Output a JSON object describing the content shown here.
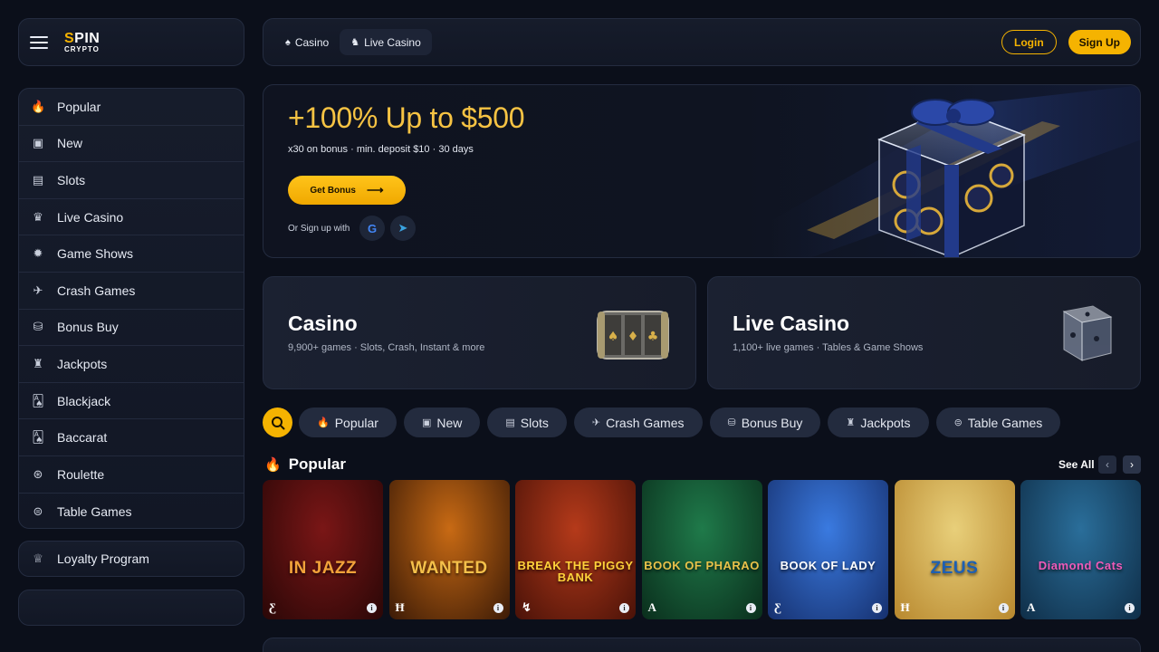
{
  "brand": {
    "line1_accent": "S",
    "line1_rest": "PIN",
    "line2": "CRYPTO"
  },
  "sidebar": {
    "items": [
      {
        "label": "Popular",
        "icon": "flame-icon",
        "glyph": "🔥"
      },
      {
        "label": "New",
        "icon": "new-box-icon",
        "glyph": "▣"
      },
      {
        "label": "Slots",
        "icon": "slot-machine-icon",
        "glyph": "▤"
      },
      {
        "label": "Live Casino",
        "icon": "dealer-icon",
        "glyph": "♛"
      },
      {
        "label": "Game Shows",
        "icon": "wheel-icon",
        "glyph": "✹"
      },
      {
        "label": "Crash Games",
        "icon": "plane-icon",
        "glyph": "✈"
      },
      {
        "label": "Bonus Buy",
        "icon": "coins-icon",
        "glyph": "⛁"
      },
      {
        "label": "Jackpots",
        "icon": "crown-stack-icon",
        "glyph": "♜"
      },
      {
        "label": "Blackjack",
        "icon": "cards-icon",
        "glyph": "🂡"
      },
      {
        "label": "Baccarat",
        "icon": "cards-icon",
        "glyph": "🂡"
      },
      {
        "label": "Roulette",
        "icon": "roulette-icon",
        "glyph": "⊛"
      },
      {
        "label": "Table Games",
        "icon": "table-icon",
        "glyph": "⊜"
      }
    ],
    "loyalty": {
      "label": "Loyalty Program",
      "icon": "crown-icon",
      "glyph": "♕"
    }
  },
  "topbar": {
    "tabs": [
      {
        "label": "Casino",
        "glyph": "♠"
      },
      {
        "label": "Live Casino",
        "glyph": "♞"
      }
    ],
    "login_label": "Login",
    "signup_label": "Sign Up"
  },
  "hero": {
    "title": "+100% Up to $500",
    "subtitle": "x30 on bonus · min. deposit $10 · 30 days",
    "cta_label": "Get Bonus",
    "cta_arrow": "⟶",
    "or_signup": "Or Sign up with",
    "google_glyph": "G",
    "telegram_glyph": "➤"
  },
  "categories": [
    {
      "title": "Casino",
      "subtitle": "9,900+ games · Slots, Crash, Instant & more"
    },
    {
      "title": "Live Casino",
      "subtitle": "1,100+ live games · Tables & Game Shows"
    }
  ],
  "filters": [
    {
      "label": "Popular",
      "glyph": "🔥"
    },
    {
      "label": "New",
      "glyph": "▣"
    },
    {
      "label": "Slots",
      "glyph": "▤"
    },
    {
      "label": "Crash Games",
      "glyph": "✈"
    },
    {
      "label": "Bonus Buy",
      "glyph": "⛁"
    },
    {
      "label": "Jackpots",
      "glyph": "♜"
    },
    {
      "label": "Table Games",
      "glyph": "⊜"
    }
  ],
  "section": {
    "title": "Popular",
    "glyph": "🔥",
    "see_all": "See All",
    "prev_glyph": "‹",
    "next_glyph": "›"
  },
  "games": [
    {
      "title": "IN JAZZ",
      "provider": "Ƹ",
      "info": "i",
      "bg": "#7a1616",
      "bg2": "#2a0707",
      "title_color": "#f2a23a"
    },
    {
      "title": "WANTED",
      "provider": "Ħ",
      "info": "i",
      "bg": "#c86a14",
      "bg2": "#3b1a06",
      "title_color": "#f4c04a"
    },
    {
      "title": "BREAK THE PIGGY BANK",
      "provider": "↯",
      "info": "i",
      "bg": "#b53a1a",
      "bg2": "#4a1208",
      "title_color": "#ffd23a"
    },
    {
      "title": "BOOK OF PHARAO",
      "provider": "A",
      "info": "i",
      "bg": "#1f7a4a",
      "bg2": "#0a2e1c",
      "title_color": "#e9c24a"
    },
    {
      "title": "BOOK OF LADY",
      "provider": "Ƹ",
      "info": "i",
      "bg": "#3a7ae0",
      "bg2": "#16306e",
      "title_color": "#ffffff"
    },
    {
      "title": "ZEUS",
      "provider": "Ħ",
      "info": "i",
      "bg": "#e8cf7a",
      "bg2": "#b8882e",
      "title_color": "#1d5fb3"
    },
    {
      "title": "Diamond Cats",
      "provider": "A",
      "info": "i",
      "bg": "#2a6e9a",
      "bg2": "#0f2e48",
      "title_color": "#f05ab8"
    }
  ],
  "colors": {
    "accent": "#f5b301",
    "bg": "#0b0f1a",
    "panel": "#161c2b",
    "chip": "#232b3e"
  }
}
